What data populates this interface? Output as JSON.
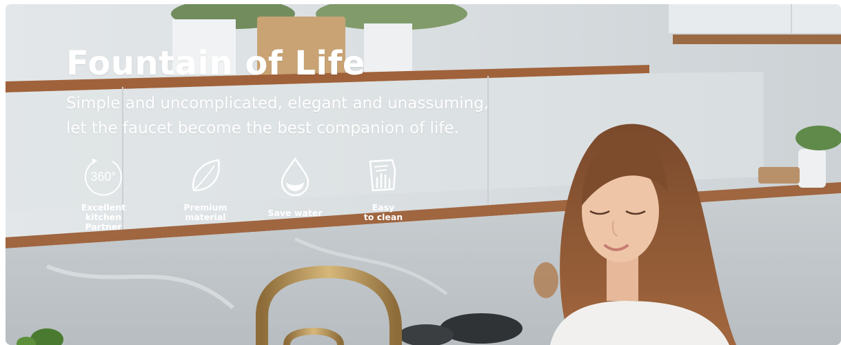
{
  "hero": {
    "title": "Fountain of Life",
    "subtitle_line1": "Simple and uncomplicated, elegant and unassuming,",
    "subtitle_line2": "let the faucet become the best companion of life."
  },
  "features": [
    {
      "icon": "rotate-360-icon",
      "icon_text": "360°",
      "label": "Excellent kitchen\nPartner"
    },
    {
      "icon": "leaf-icon",
      "label": "Premium\nmaterial"
    },
    {
      "icon": "water-drop-icon",
      "label": "Save water"
    },
    {
      "icon": "hand-wipe-icon",
      "label": "Easy\nto clean"
    }
  ],
  "colors": {
    "text": "#ffffff",
    "wood": "#a0623a",
    "faucet_gold": "#b8965a",
    "wall": "#d9dee1"
  }
}
